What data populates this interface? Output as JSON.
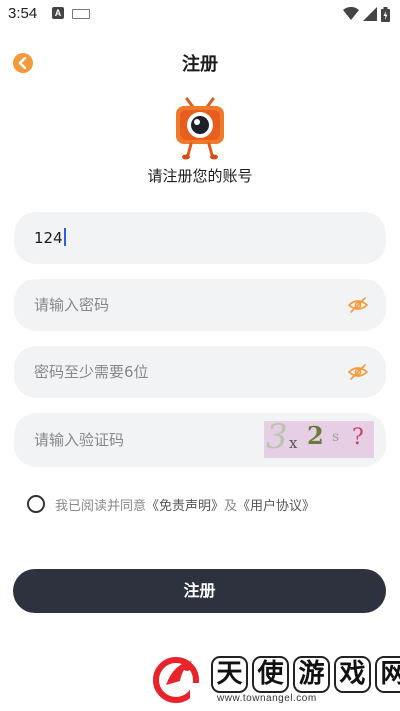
{
  "status_bar": {
    "time": "3:54",
    "notification_a": "A"
  },
  "header": {
    "title": "注册"
  },
  "subtitle": "请注册您的账号",
  "fields": {
    "phone": {
      "value": "124"
    },
    "password": {
      "placeholder": "请输入密码"
    },
    "confirm_password": {
      "placeholder": "密码至少需要6位"
    },
    "captcha": {
      "placeholder": "请输入验证码",
      "image_chars": [
        "3",
        "x",
        "2",
        "s",
        "?"
      ]
    }
  },
  "agreement": {
    "prefix": "我已阅读并同意",
    "disclaimer": "《免责声明》",
    "joiner": "及",
    "user_agreement": "《用户协议》"
  },
  "submit_label": "注册",
  "watermark": {
    "chars": [
      "天",
      "使",
      "游",
      "戏",
      "网"
    ],
    "url": "www.townangel.com"
  },
  "colors": {
    "accent": "#f39a3b",
    "button": "#2e323f",
    "field_bg": "#f2f3f5",
    "captcha_bg": "#e6cfe5"
  }
}
